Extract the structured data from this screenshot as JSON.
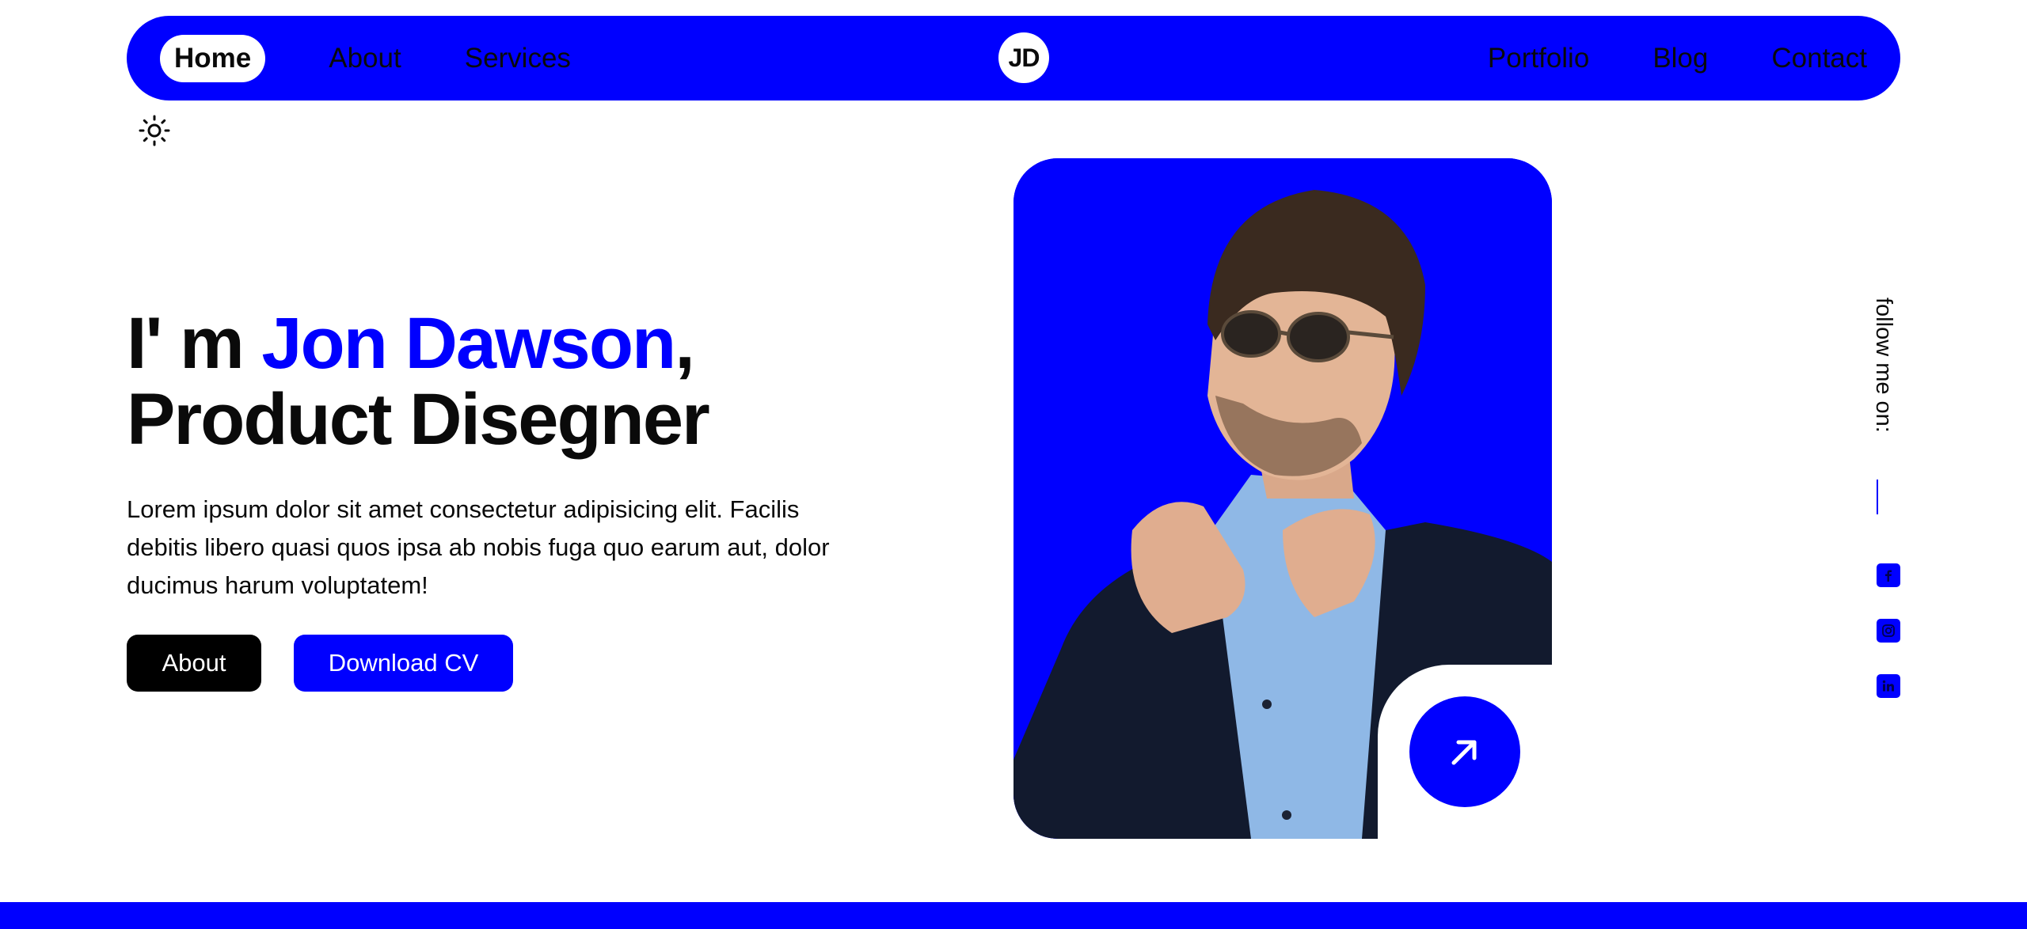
{
  "nav": {
    "left_links": [
      "Home",
      "About",
      "Services"
    ],
    "right_links": [
      "Portfolio",
      "Blog",
      "Contact"
    ],
    "active": "Home",
    "logo_text": "JD",
    "background_color": "#0000ff"
  },
  "theme_toggle": {
    "icon": "sun-icon"
  },
  "hero": {
    "title_prefix": "I' m ",
    "name": "Jon Dawson",
    "title_suffix": ",",
    "title_line2": "Product Disegner",
    "description": "Lorem ipsum dolor sit amet consectetur adipisicing elit. Facilis debitis libero quasi quos ipsa ab nobis fuga quo earum aut, dolor ducimus harum voluptatem!",
    "buttons": {
      "about": "About",
      "download_cv": "Download CV"
    },
    "accent_color": "#0000ff",
    "image": {
      "subject": "portrait-photo",
      "cta_icon": "arrow-up-right-icon"
    }
  },
  "social": {
    "label": "follow me on:",
    "icons": [
      "facebook-icon",
      "instagram-icon",
      "linkedin-icon"
    ]
  },
  "colors": {
    "primary": "#0000ff",
    "dark": "#000000",
    "text": "#0a0a0a",
    "background": "#ffffff"
  }
}
